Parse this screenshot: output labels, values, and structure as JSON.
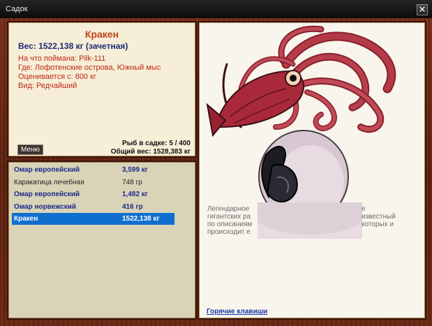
{
  "window": {
    "title": "Садок",
    "close_label": "✕"
  },
  "info": {
    "title": "Кракен",
    "weight_line": "Вес: 1522,138 кг (зачетная)",
    "caught_on": "На что поймана: Pilk-111",
    "location": "Где: Лофотенские острова, Южный мыс",
    "valued_from": "Оценивается с: 800 кг",
    "kind": "Вид: Редчайший",
    "menu_label": "Меню",
    "fish_count": "Рыб в садке: 5 / 400",
    "total_weight": "Общий вес: 1528,383 кг"
  },
  "catch_list": [
    {
      "name": "Омар европейский",
      "weight": "3,599 кг",
      "style": "bold"
    },
    {
      "name": "Каракатица лечебная",
      "weight": "748 гр",
      "style": "plain"
    },
    {
      "name": "Омар европейский",
      "weight": "1,482 кг",
      "style": "bold"
    },
    {
      "name": "Омар норвежский",
      "weight": "416 гр",
      "style": "bold"
    },
    {
      "name": "Кракен",
      "weight": "1522,138 кг",
      "style": "selected"
    }
  ],
  "description": {
    "left_lines": [
      "Легендарное",
      "гигантских ра",
      "по описаниям",
      "происходит е"
    ],
    "right_lines": [
      "е",
      "известный",
      "которых и"
    ]
  },
  "hotkeys_label": "Горячие клавиши",
  "colors": {
    "wood": "#6b2714",
    "parchment": "#f6eed6",
    "list_bg": "#d9d3b7",
    "title_orange": "#c0421a",
    "weight_blue": "#1c2a78",
    "detail_red": "#c02818",
    "selection": "#0f6fcf",
    "squid": "#a8293a"
  },
  "icons": {
    "close": "close-icon",
    "image": "kraken-illustration"
  }
}
